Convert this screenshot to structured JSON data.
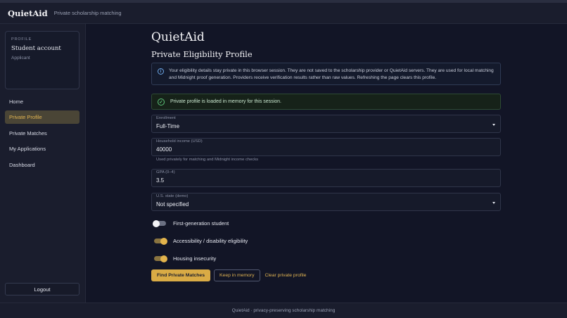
{
  "header": {
    "brand": "QuietAid",
    "subtitle": "Private scholarship matching"
  },
  "sidebar": {
    "profile": {
      "label": "PROFILE",
      "name": "Student account",
      "role": "Applicant"
    },
    "items": [
      {
        "label": "Home"
      },
      {
        "label": "Private Profile",
        "active": true
      },
      {
        "label": "Private Matches"
      },
      {
        "label": "My Applications"
      },
      {
        "label": "Dashboard"
      }
    ],
    "logout_label": "Logout"
  },
  "main": {
    "app_title": "QuietAid",
    "page_title": "Private Eligibility Profile",
    "info_text": "Your eligibility details stay private in this browser session. They are not saved to the scholarship provider or QuietAid servers. They are used for local matching and Midnight proof generation. Providers receive verification results rather than raw values. Refreshing the page clears this profile.",
    "status_text": "Private profile is loaded in memory for this session.",
    "fields": {
      "enrollment": {
        "label": "Enrollment",
        "value": "Full-Time"
      },
      "income": {
        "label": "Household income (USD)",
        "value": "40000",
        "helper": "Used privately for matching and Midnight income checks"
      },
      "gpa": {
        "label": "GPA (0–4)",
        "value": "3.5"
      },
      "state": {
        "label": "U.S. state (demo)",
        "value": "Not specified"
      }
    },
    "toggles": [
      {
        "label": "First-generation student",
        "on": false
      },
      {
        "label": "Accessibility / disability eligibility",
        "on": true
      },
      {
        "label": "Housing insecurity",
        "on": true
      }
    ],
    "actions": {
      "find": "Find Private Matches",
      "keep": "Keep in memory",
      "clear": "Clear private profile"
    }
  },
  "footer": {
    "text": "QuietAid · privacy-preserving scholarship matching"
  },
  "colors": {
    "accent": "#d9ab45",
    "success": "#5dc47a",
    "info": "#6da8e8",
    "background": "#121526"
  }
}
